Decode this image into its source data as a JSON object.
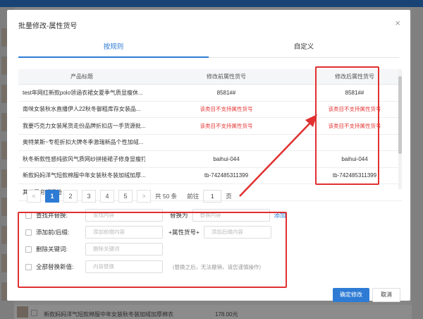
{
  "dialog": {
    "title": "批量修改-属性货号",
    "close": "×"
  },
  "tabs": [
    {
      "label": "按规则",
      "active": true
    },
    {
      "label": "自定义",
      "active": false
    }
  ],
  "table": {
    "headers": [
      "产品标题",
      "修改前属性货号",
      "修改后属性货号"
    ],
    "rows": [
      {
        "title": "test年网红新款polo领涵衣裙女夏季气质显瘦休...",
        "before": "8581##",
        "after": "8581##",
        "warn": false
      },
      {
        "title": "南咪女装秋水直播伊人22秋冬御粗库存女装品...",
        "before": "该类目不支持属性货号",
        "after": "该类目不支持属性货号",
        "warn": true
      },
      {
        "title": "我要巧克力女装尾货走份品牌折扣店一手货源批...",
        "before": "该类目不支持属性货号",
        "after": "该类目不支持属性货号",
        "warn": true
      },
      {
        "title": "奥特莱斯~专柜折扣大牌冬季激瑞新品个性加绒...",
        "before": "",
        "after": "",
        "warn": false
      },
      {
        "title": "秋冬新款性感纯欲风气质网纱拼接裙子修身显瘦打...",
        "before": "baihui-044",
        "after": "baihui-044",
        "warn": false
      },
      {
        "title": "新款妈妈洋气短款棉服中年女装秋冬装加绒加厚...",
        "before": "tb-742485311399",
        "after": "tb-742485311399",
        "warn": false
      },
      {
        "title": "其味无穷额温枪",
        "before": "",
        "after": "",
        "warn": false
      }
    ]
  },
  "pager": {
    "prev": "<",
    "pages": [
      "1",
      "2",
      "3",
      "4",
      "5"
    ],
    "next": ">",
    "total": "共 50 条",
    "goto_label": "前往",
    "goto_value": "1",
    "page_unit": "页"
  },
  "rules": {
    "find_replace": {
      "label": "查找并替换:",
      "find_placeholder": "查找内容",
      "replace_label": "替换为",
      "replace_placeholder": "替换内容",
      "add": "添加"
    },
    "prefix_suffix": {
      "label": "添加前/后缀:",
      "prefix_placeholder": "添加前缀内容",
      "middle": "+属性货号+",
      "suffix_placeholder": "添加后缀内容"
    },
    "delete_keyword": {
      "label": "删除关键词:",
      "placeholder": "删除关键词"
    },
    "replace_all": {
      "label": "全部替换新值:",
      "placeholder": "内容替换",
      "hint": "(替换之后，无法撤销，请您谨慎操作)"
    }
  },
  "buttons": {
    "confirm": "确定修改",
    "cancel": "取消"
  },
  "background": {
    "bottom_text": "新款妈妈洋气短款棉服中年女装秋冬装加绒加厚棉衣",
    "bottom_price": "178.00元"
  },
  "colors": {
    "accent": "#2d7bd4",
    "annotation": "#e03030",
    "warning": "#e53b3b"
  }
}
